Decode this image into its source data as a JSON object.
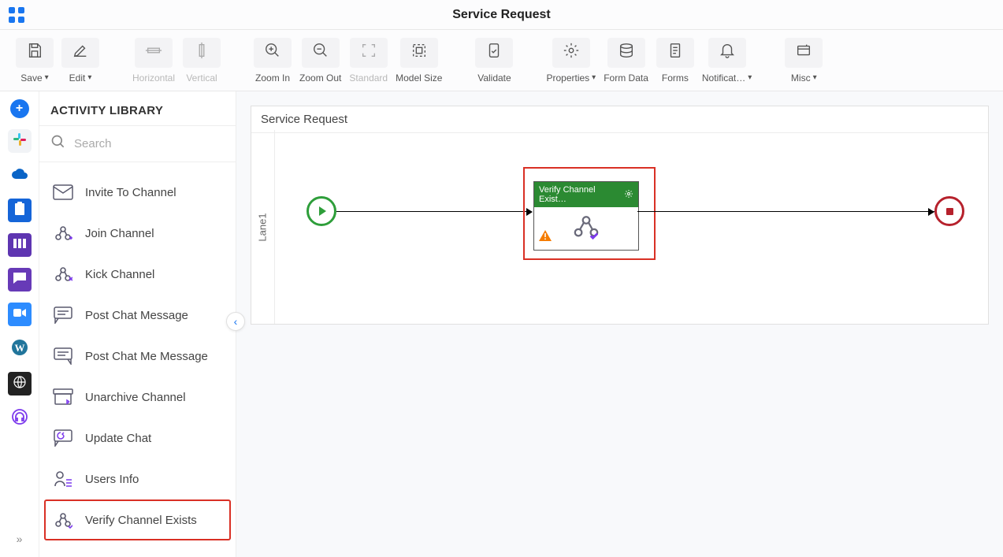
{
  "header": {
    "title": "Service Request"
  },
  "toolbar": {
    "save": "Save",
    "edit": "Edit",
    "horizontal": "Horizontal",
    "vertical": "Vertical",
    "zoomin": "Zoom In",
    "zoomout": "Zoom Out",
    "standard": "Standard",
    "modelsize": "Model Size",
    "validate": "Validate",
    "properties": "Properties",
    "formdata": "Form Data",
    "forms": "Forms",
    "notifications": "Notificat…",
    "misc": "Misc"
  },
  "sidebar": {
    "title": "ACTIVITY LIBRARY",
    "search_placeholder": "Search",
    "activities": [
      {
        "label": "Invite To Channel",
        "icon": "mail"
      },
      {
        "label": "Join Channel",
        "icon": "share-plus"
      },
      {
        "label": "Kick Channel",
        "icon": "share-x"
      },
      {
        "label": "Post Chat Message",
        "icon": "chat"
      },
      {
        "label": "Post Chat Me Message",
        "icon": "chat-me"
      },
      {
        "label": "Unarchive Channel",
        "icon": "unarchive"
      },
      {
        "label": "Update Chat",
        "icon": "chat-update"
      },
      {
        "label": "Users Info",
        "icon": "user-list"
      },
      {
        "label": "Verify Channel Exists",
        "icon": "share-check"
      }
    ],
    "selected_index": 8
  },
  "canvas": {
    "title": "Service Request",
    "lane_label": "Lane1",
    "task": {
      "title": "Verify Channel Exist…"
    }
  }
}
